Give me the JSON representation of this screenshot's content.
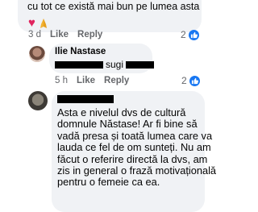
{
  "top_comment": {
    "text": "cu tot ce există mai bun pe lumea asta",
    "emojis": [
      "heart-emoji",
      "folded-hands-emoji"
    ],
    "time": "3 d",
    "like_label": "Like",
    "reply_label": "Reply",
    "reaction_count": "2"
  },
  "reply_comment": {
    "author": "Ilie Nastase",
    "text": "sugi",
    "time": "5 h",
    "like_label": "Like",
    "reply_label": "Reply",
    "reaction_count": "2"
  },
  "bottom_comment": {
    "lines": [
      "Asta e nivelul dvs de cultură",
      "domnule Năstase! Ar fi bine să",
      "vadă presa și toată lumea care va",
      "lauda ce fel de om sunteți. Nu am",
      "făcut o referire directă la dvs, am",
      "zis in general o frază motivațională",
      "pentru o femeie ca ea."
    ]
  },
  "colors": {
    "bubble": "#f0f2f5",
    "meta_text": "#65676b",
    "like_blue": "#1877f2",
    "heart_red": "#e0245e"
  }
}
